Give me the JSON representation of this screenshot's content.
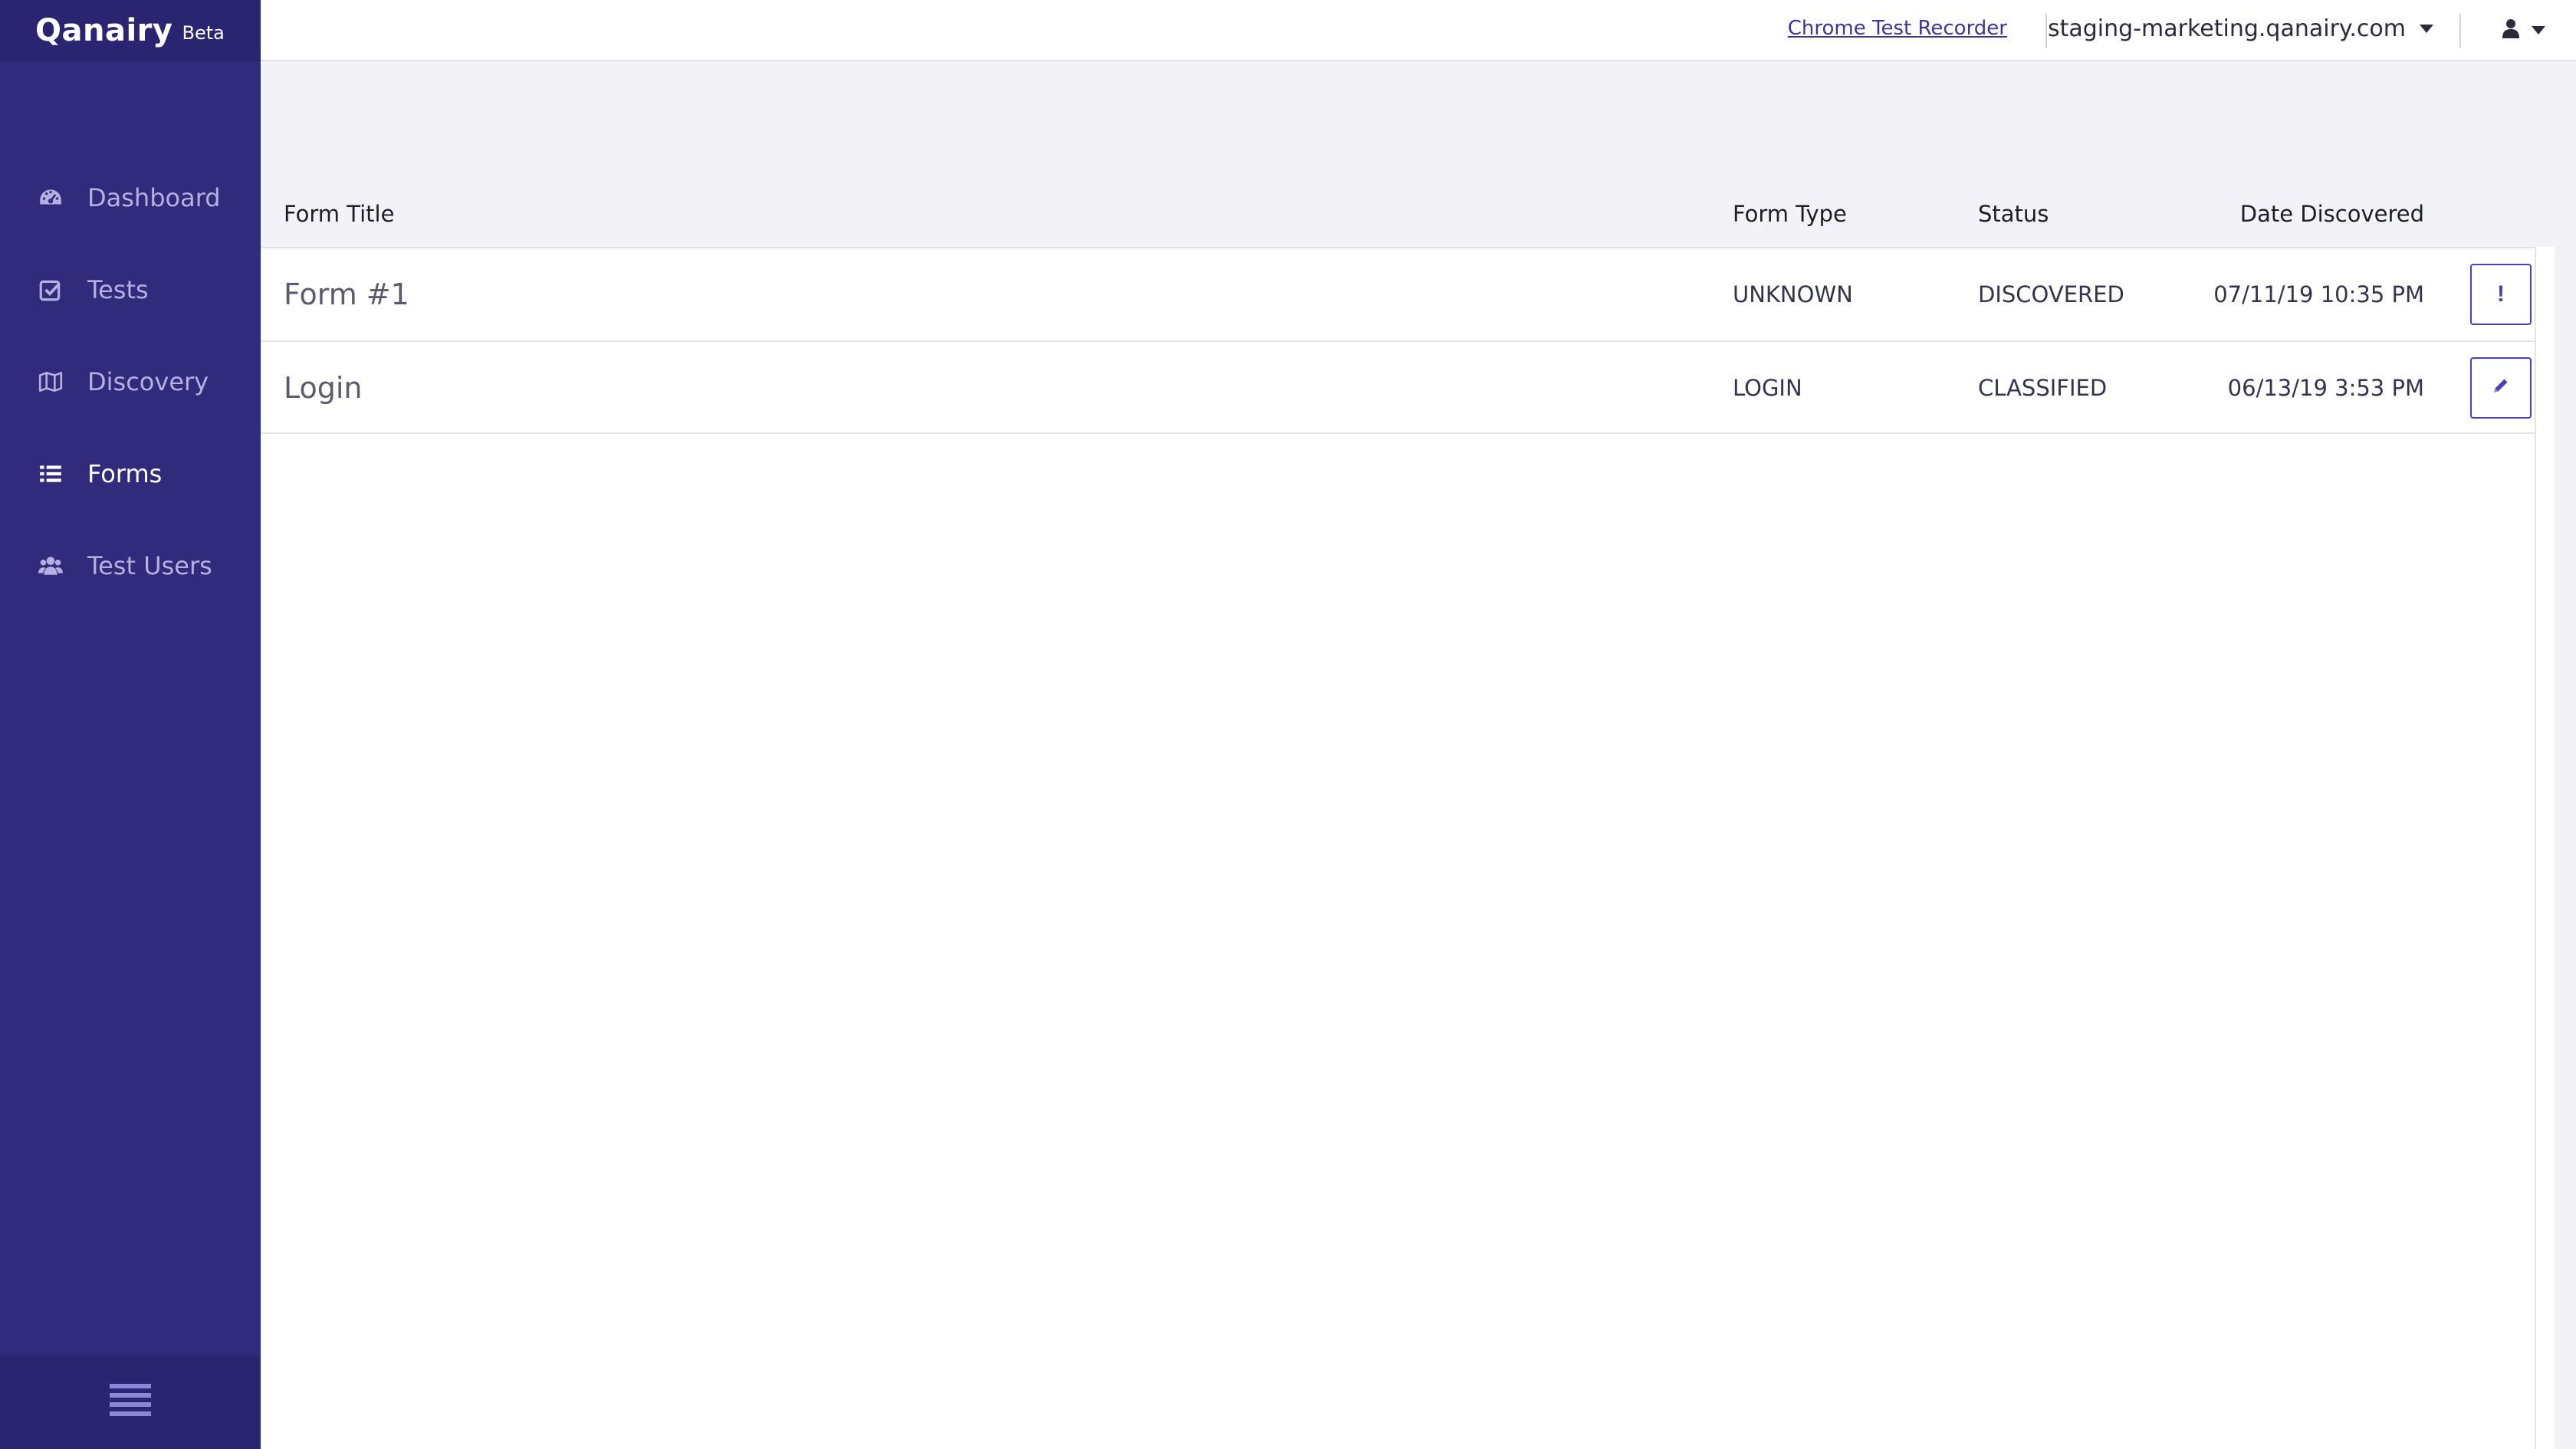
{
  "brand": {
    "logo_text": "Qanairy",
    "beta_label": "Beta"
  },
  "sidebar": {
    "items": [
      {
        "label": "Dashboard",
        "icon": "dashboard-icon",
        "active": false
      },
      {
        "label": "Tests",
        "icon": "check-square-icon",
        "active": false
      },
      {
        "label": "Discovery",
        "icon": "map-icon",
        "active": false
      },
      {
        "label": "Forms",
        "icon": "list-icon",
        "active": true
      },
      {
        "label": "Test Users",
        "icon": "users-icon",
        "active": false
      }
    ],
    "footer_icon": "hamburger-menu-icon"
  },
  "topbar": {
    "recorder_link": "Chrome Test Recorder",
    "site": "staging-marketing.qanairy.com",
    "user_icon": "user-icon"
  },
  "table": {
    "headers": {
      "title": "Form Title",
      "type": "Form Type",
      "status": "Status",
      "date": "Date Discovered"
    },
    "rows": [
      {
        "title": "Form #1",
        "type": "UNKNOWN",
        "status": "DISCOVERED",
        "date": "07/11/19 10:35 PM",
        "action_icon": "exclamation-icon",
        "action_glyph": "!"
      },
      {
        "title": "Login",
        "type": "LOGIN",
        "status": "CLASSIFIED",
        "date": "06/13/19 3:53 PM",
        "action_icon": "pencil-icon",
        "action_glyph": ""
      }
    ]
  },
  "colors": {
    "sidebar_bg": "#322a7b",
    "sidebar_header_bg": "#2b2471",
    "accent": "#4b40b5",
    "nav_inactive": "#b6b0e2",
    "nav_active": "#ffffff"
  }
}
